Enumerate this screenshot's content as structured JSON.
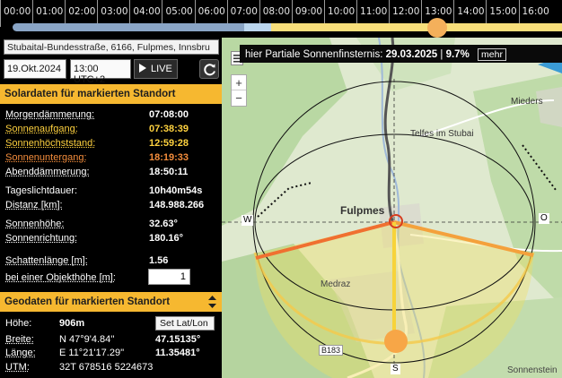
{
  "timeline": {
    "hours": [
      "00:00",
      "01:00",
      "02:00",
      "03:00",
      "04:00",
      "05:00",
      "06:00",
      "07:00",
      "08:00",
      "09:00",
      "10:00",
      "11:00",
      "12:00",
      "13:00",
      "14:00",
      "15:00",
      "16:00"
    ],
    "colors": {
      "night": "#8aa5c6",
      "twilight": "#bcd7ef",
      "day": "#f7de7a",
      "handle": "#f4b05b"
    }
  },
  "location": {
    "address": "Stubaital-Bundesstraße, 6166, Fulpmes, Innsbru",
    "date": "19.Okt.2024",
    "time": "13:00 UTC+2",
    "live_label": "LIVE"
  },
  "solar": {
    "title": "Solardaten für markierten Standort",
    "rows": [
      {
        "label": "Morgendämmerung:",
        "value": "07:08:00",
        "color": "#ffffff",
        "valcolor": "#ffffff"
      },
      {
        "label": "Sonnenaufgang:",
        "value": "07:38:39",
        "color": "#ffd23f",
        "valcolor": "#ffd23f"
      },
      {
        "label": "Sonnenhöchststand:",
        "value": "12:59:28",
        "color": "#ffd23f",
        "valcolor": "#ffd23f"
      },
      {
        "label": "Sonnenuntergang:",
        "value": "18:19:33",
        "color": "#f48d3c",
        "valcolor": "#f48d3c"
      },
      {
        "label": "Abenddämmerung:",
        "value": "18:50:11",
        "color": "#ffffff",
        "valcolor": "#ffffff"
      }
    ],
    "rows2": [
      {
        "label": "Tageslichtdauer:",
        "value": "10h40m54s",
        "dotted": false
      },
      {
        "label": "Distanz [km]:",
        "value": "148.988.266",
        "dotted": true
      }
    ],
    "rows3": [
      {
        "label": "Sonnenhöhe:",
        "value": "32.63°"
      },
      {
        "label": "Sonnenrichtung:",
        "value": "180.16°"
      }
    ],
    "shadow_label": "Schattenlänge [m]:",
    "shadow_value": "1.56",
    "object_label": "bei einer Objekthöhe [m]:",
    "object_value": "1"
  },
  "geo": {
    "title": "Geodaten für markierten Standort",
    "height_label": "Höhe:",
    "height_value": "906m",
    "setlatlon_label": "Set Lat/Lon",
    "lat_label": "Breite:",
    "lat_dms": "N 47°9'4.84''",
    "lat_dec": "47.15135°",
    "lon_label": "Länge:",
    "lon_dms": "E 11°21'17.29''",
    "lon_dec": "11.35481°",
    "utm_label": "UTM:",
    "utm_value": "32T 678516 5224673"
  },
  "map": {
    "eclipse_prefix": "hier Partiale Sonnenfinsternis:",
    "eclipse_date": "29.03.2025",
    "eclipse_separator": "|",
    "eclipse_percent": "9.7%",
    "mehr_label": "mehr",
    "zoom_in": "+",
    "zoom_out": "−",
    "places": {
      "fulpmes": "Fulpmes",
      "telfes": "Telfes im Stubai",
      "mieders": "Mieders",
      "medraz": "Medraz",
      "sonnenstein": "Sonnenstein",
      "road": "B183"
    },
    "compass": {
      "west": "W",
      "east": "O",
      "south": "S"
    },
    "colors": {
      "sunrise_line": "#f07030",
      "noon_line": "#f7d33a",
      "sunset_line": "#f4a13c",
      "sun": "#f7a647",
      "ring": "#111111"
    }
  }
}
